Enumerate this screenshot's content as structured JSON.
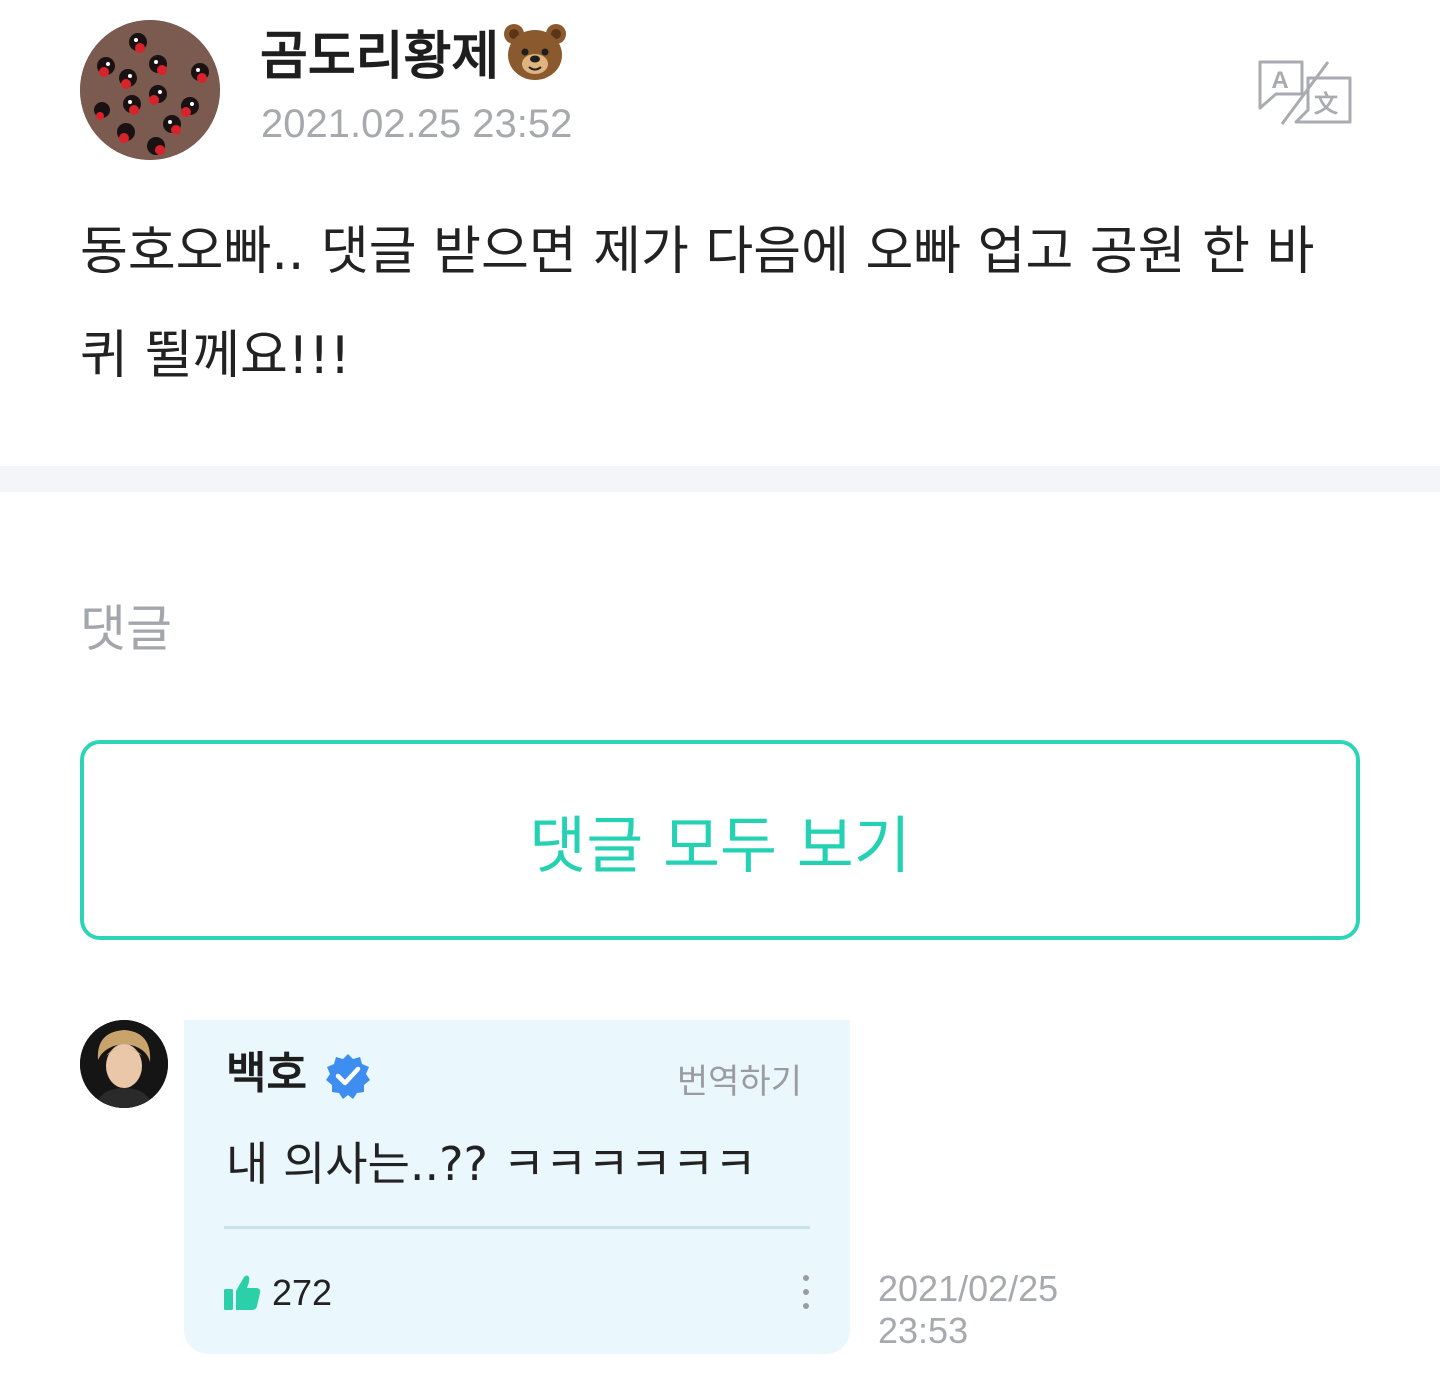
{
  "post": {
    "author_name": "곰도리황제",
    "author_emoji": "bear-face-icon",
    "timestamp": "2021.02.25 23:52",
    "translate_icon": "translate-icon",
    "body": "동호오빠.. 댓글 받으면 제가 다음에 오빠 업고 공원 한 바퀴 뛸께요!!!"
  },
  "comments_section": {
    "title": "댓글",
    "view_all_label": "댓글 모두 보기"
  },
  "comment": {
    "author": "백호",
    "verified_icon": "verified-badge-icon",
    "translate_label": "번역하기",
    "text": "내 의사는..?? ㅋㅋㅋㅋㅋㅋ",
    "likes": "272",
    "date": "2021/02/25",
    "time": "23:53"
  },
  "colors": {
    "accent": "#24d1b3",
    "bubble_bg": "#eaf7fd",
    "verified": "#3d8ef0",
    "muted_text": "#a7a9ae",
    "divider": "#f4f5f8"
  }
}
